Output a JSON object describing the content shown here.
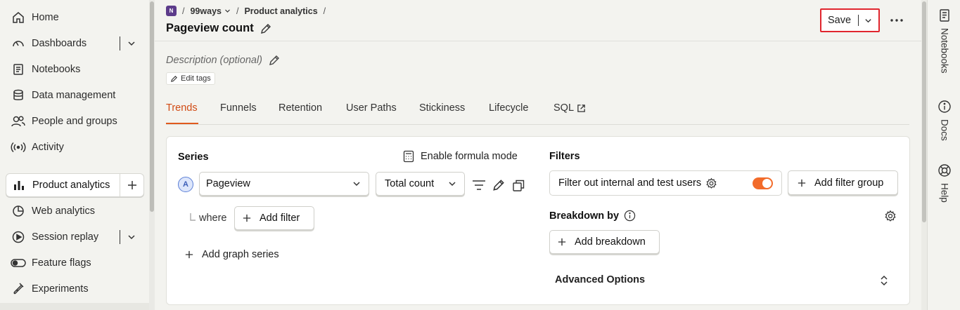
{
  "sidebar": {
    "items": [
      {
        "label": "Home",
        "icon": "home-icon"
      },
      {
        "label": "Dashboards",
        "icon": "dashboard-icon",
        "expandable": true
      },
      {
        "label": "Notebooks",
        "icon": "notebook-icon"
      },
      {
        "label": "Data management",
        "icon": "database-icon"
      },
      {
        "label": "People and groups",
        "icon": "people-icon"
      },
      {
        "label": "Activity",
        "icon": "activity-icon"
      },
      {
        "label": "Product analytics",
        "icon": "bar-chart-icon",
        "active": true
      },
      {
        "label": "Web analytics",
        "icon": "pie-chart-icon"
      },
      {
        "label": "Session replay",
        "icon": "play-icon",
        "expandable": true
      },
      {
        "label": "Feature flags",
        "icon": "toggle-icon"
      },
      {
        "label": "Experiments",
        "icon": "flask-icon"
      }
    ]
  },
  "header": {
    "org_initial": "N",
    "project": "99ways",
    "section": "Product analytics",
    "title": "Pageview count",
    "save_label": "Save"
  },
  "meta": {
    "description_placeholder": "Description (optional)",
    "edit_tags_label": "Edit tags"
  },
  "tabs": [
    "Trends",
    "Funnels",
    "Retention",
    "User Paths",
    "Stickiness",
    "Lifecycle",
    "SQL"
  ],
  "active_tab": "Trends",
  "query": {
    "series_title": "Series",
    "formula_label": "Enable formula mode",
    "series_letter": "A",
    "event": "Pageview",
    "aggregation": "Total count",
    "where_label": "where",
    "add_filter_label": "Add filter",
    "add_series_label": "Add graph series",
    "filters_title": "Filters",
    "internal_filter_label": "Filter out internal and test users",
    "internal_filter_enabled": true,
    "add_filter_group_label": "Add filter group",
    "breakdown_title": "Breakdown by",
    "add_breakdown_label": "Add breakdown",
    "advanced_label": "Advanced Options"
  },
  "rail": [
    {
      "label": "Notebooks",
      "icon": "notebook-icon"
    },
    {
      "label": "Docs",
      "icon": "info-icon"
    },
    {
      "label": "Help",
      "icon": "lifebuoy-icon"
    }
  ],
  "colors": {
    "accent": "#e05a1e",
    "save_highlight": "#e0262e",
    "toggle_on": "#f26b2a",
    "series_badge": "#5b7fd6"
  }
}
